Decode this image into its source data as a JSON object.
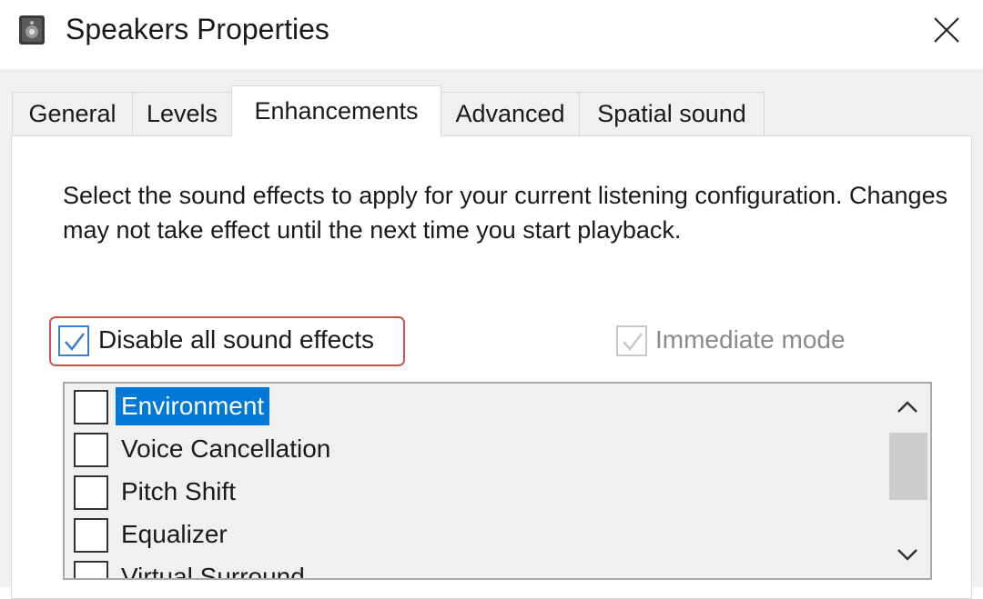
{
  "window": {
    "title": "Speakers Properties",
    "icons": {
      "app": "speaker-icon",
      "close": "close-icon"
    }
  },
  "tabs": [
    {
      "label": "General",
      "active": false
    },
    {
      "label": "Levels",
      "active": false
    },
    {
      "label": "Enhancements",
      "active": true
    },
    {
      "label": "Advanced",
      "active": false
    },
    {
      "label": "Spatial sound",
      "active": false
    }
  ],
  "enhancements": {
    "description": "Select the sound effects to apply for your current listening configuration. Changes may not take effect until the next time you start playback.",
    "disable_all": {
      "label": "Disable all sound effects",
      "checked": true,
      "highlighted": true
    },
    "immediate_mode": {
      "label": "Immediate mode",
      "checked": true,
      "enabled": false
    },
    "effects": [
      {
        "label": "Environment",
        "checked": false,
        "selected": true
      },
      {
        "label": "Voice Cancellation",
        "checked": false,
        "selected": false
      },
      {
        "label": "Pitch Shift",
        "checked": false,
        "selected": false
      },
      {
        "label": "Equalizer",
        "checked": false,
        "selected": false
      },
      {
        "label": "Virtual Surround",
        "checked": false,
        "selected": false
      }
    ]
  },
  "colors": {
    "accent": "#0078d7",
    "highlight_border": "#c9584b",
    "checkbox_check": "#3b7fd1",
    "disabled_text": "#8a8a8a"
  }
}
